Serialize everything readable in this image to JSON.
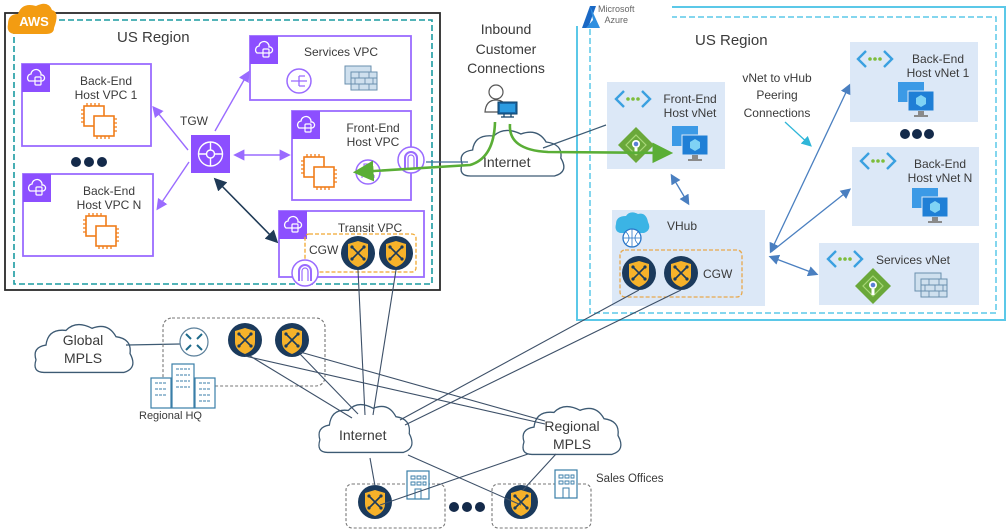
{
  "aws": {
    "badge": "AWS",
    "region_label": "US Region",
    "tgw_label": "TGW",
    "vpcs": {
      "backend_1": [
        "Back-End",
        "Host VPC 1"
      ],
      "backend_n": [
        "Back-End",
        "Host VPC N"
      ],
      "services": "Services VPC",
      "frontend": [
        "Front-End",
        "Host VPC"
      ],
      "transit": "Transit VPC"
    },
    "cgw_label": "CGW"
  },
  "inbound": {
    "label": [
      "Inbound",
      "Customer",
      "Connections"
    ],
    "internet_label": "Internet"
  },
  "azure": {
    "brand": [
      "Microsoft",
      "Azure"
    ],
    "region_label": "US Region",
    "peering_label": [
      "vNet to vHub",
      "Peering",
      "Connections"
    ],
    "vnets": {
      "frontend": [
        "Front-End",
        "Host vNet"
      ],
      "backend_1": [
        "Back-End",
        "Host vNet 1"
      ],
      "backend_n": [
        "Back-End",
        "Host vNet N"
      ],
      "services": "Services vNet"
    },
    "vhub_label": "VHub",
    "cgw_label": "CGW"
  },
  "wan": {
    "global_mpls": [
      "Global",
      "MPLS"
    ],
    "regional_hq": "Regional HQ",
    "internet": "Internet",
    "regional_mpls": [
      "Regional",
      "MPLS"
    ],
    "sales_offices": "Sales Offices"
  },
  "colors": {
    "aws_orange": "#f39c12",
    "aws_purple": "#8c4fff",
    "teal_dashed": "#1a9ba1",
    "azure_cyan": "#5bc8e8",
    "azure_panel": "#dce8f7",
    "green_flow": "#5aae36",
    "cgw_navy": "#1b3a5c",
    "cgw_gold": "#f6b22a"
  }
}
